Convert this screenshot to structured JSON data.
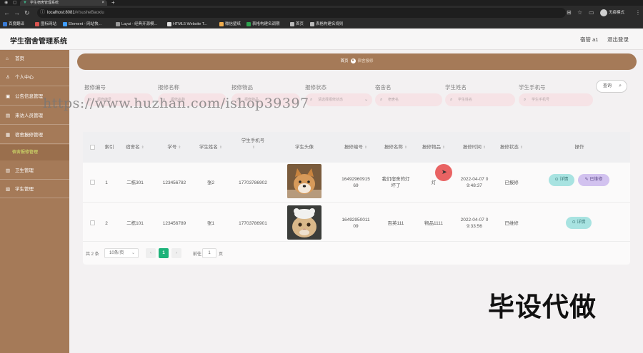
{
  "browser": {
    "tab_title": "学生宿舍管理系统",
    "url_host": "localhost:8081",
    "url_path": "/#/susheBaoxiu",
    "profile_label": "无痕模式",
    "bookmarks": [
      "百度翻译",
      "图标网站",
      "Element - 网站快...",
      "Layui - 经典开源模...",
      "HTML5 Website T...",
      "微信壁纸",
      "表格构建名调期",
      "首页",
      "表格构建名规则"
    ]
  },
  "header": {
    "title": "学生宿舍管理系统",
    "user": "宿管 a1",
    "logout": "退出登录"
  },
  "sidebar": {
    "items": [
      {
        "label": "首页",
        "icon": "home-icon"
      },
      {
        "label": "个人中心",
        "icon": "user-icon"
      },
      {
        "label": "公告信息管理",
        "icon": "notice-icon"
      },
      {
        "label": "来访人员管理",
        "icon": "visitor-icon"
      },
      {
        "label": "宿舍报修管理",
        "icon": "repair-icon"
      },
      {
        "label": "卫生管理",
        "icon": "hygiene-icon"
      },
      {
        "label": "学生管理",
        "icon": "student-icon"
      }
    ],
    "active_sub": "宿舍报修管理"
  },
  "breadcrumb": {
    "home": "首页",
    "current": "宿舍报修"
  },
  "search": {
    "fields": [
      {
        "label": "报修编号",
        "placeholder": "报修编号"
      },
      {
        "label": "报修名称",
        "placeholder": "报修名称"
      },
      {
        "label": "报修物品",
        "placeholder": "报修物品"
      },
      {
        "label": "报修状态",
        "placeholder": "请选择报修状态"
      },
      {
        "label": "宿舍名",
        "placeholder": "宿舍名"
      },
      {
        "label": "学生姓名",
        "placeholder": "学生姓名"
      },
      {
        "label": "学生手机号",
        "placeholder": "学生手机号"
      }
    ],
    "button": "查询"
  },
  "watermark": "https://www.huzhan.com/ishop39397",
  "table": {
    "columns": [
      "索引",
      "宿舍名",
      "学号",
      "学生姓名",
      "学生手机号",
      "学生头像",
      "报修编号",
      "报修名称",
      "报修物品",
      "报修时间",
      "报修状态",
      "操作"
    ],
    "rows": [
      {
        "index": "1",
        "dorm": "二栋301",
        "student_no": "123456782",
        "name": "张2",
        "phone": "17703786902",
        "avatar": "shiba-dog-photo",
        "repair_no_a": "16492960915",
        "repair_no_b": "69",
        "repair_name_a": "我们宿舍的灯",
        "repair_name_b": "坏了",
        "item": "灯",
        "time_a": "2022-04-07 0",
        "time_b": "9:48:37",
        "status": "已报修",
        "actions": [
          "详情",
          "已维修"
        ]
      },
      {
        "index": "2",
        "dorm": "二栋101",
        "student_no": "123456789",
        "name": "张1",
        "phone": "17703786901",
        "avatar": "cat-photo",
        "repair_no_a": "16492950011",
        "repair_no_b": "09",
        "repair_name_a": "百英111",
        "repair_name_b": "",
        "item": "物品1111",
        "time_a": "2022-04-07 0",
        "time_b": "9:33:56",
        "status": "已维修",
        "actions": [
          "详情"
        ]
      }
    ]
  },
  "pagination": {
    "total": "共 2 条",
    "page_size": "10条/页",
    "current": "1",
    "goto": "前往",
    "jump_value": "1",
    "unit": "页"
  },
  "overlay_text": "毕设代做"
}
